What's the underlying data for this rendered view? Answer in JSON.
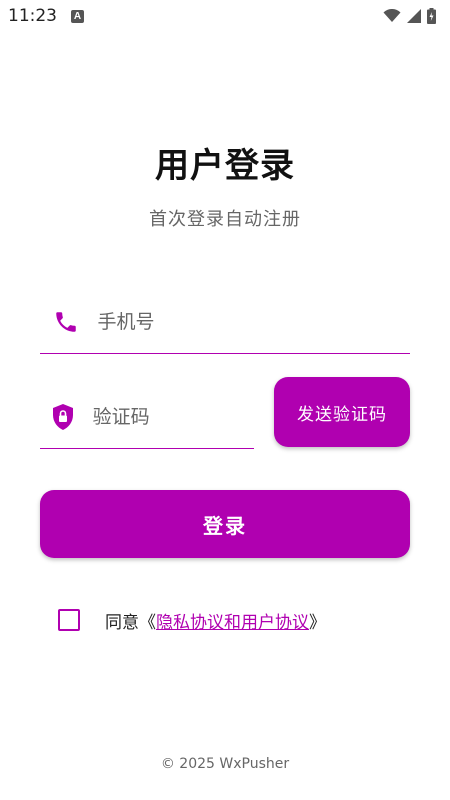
{
  "status_bar": {
    "time": "11:23",
    "notification_icon": "A"
  },
  "title": "用户登录",
  "subtitle": "首次登录自动注册",
  "phone_field": {
    "icon": "phone-icon",
    "placeholder": "手机号"
  },
  "code_field": {
    "icon": "shield-lock-icon",
    "placeholder": "验证码"
  },
  "send_code_button": "发送验证码",
  "login_button": "登录",
  "agreement": {
    "prefix": "同意《",
    "link": "隐私协议和用户协议",
    "suffix": "》",
    "checked": false
  },
  "footer": "© 2025 WxPusher",
  "colors": {
    "accent": "#b000b0",
    "background": "#ffffff"
  }
}
